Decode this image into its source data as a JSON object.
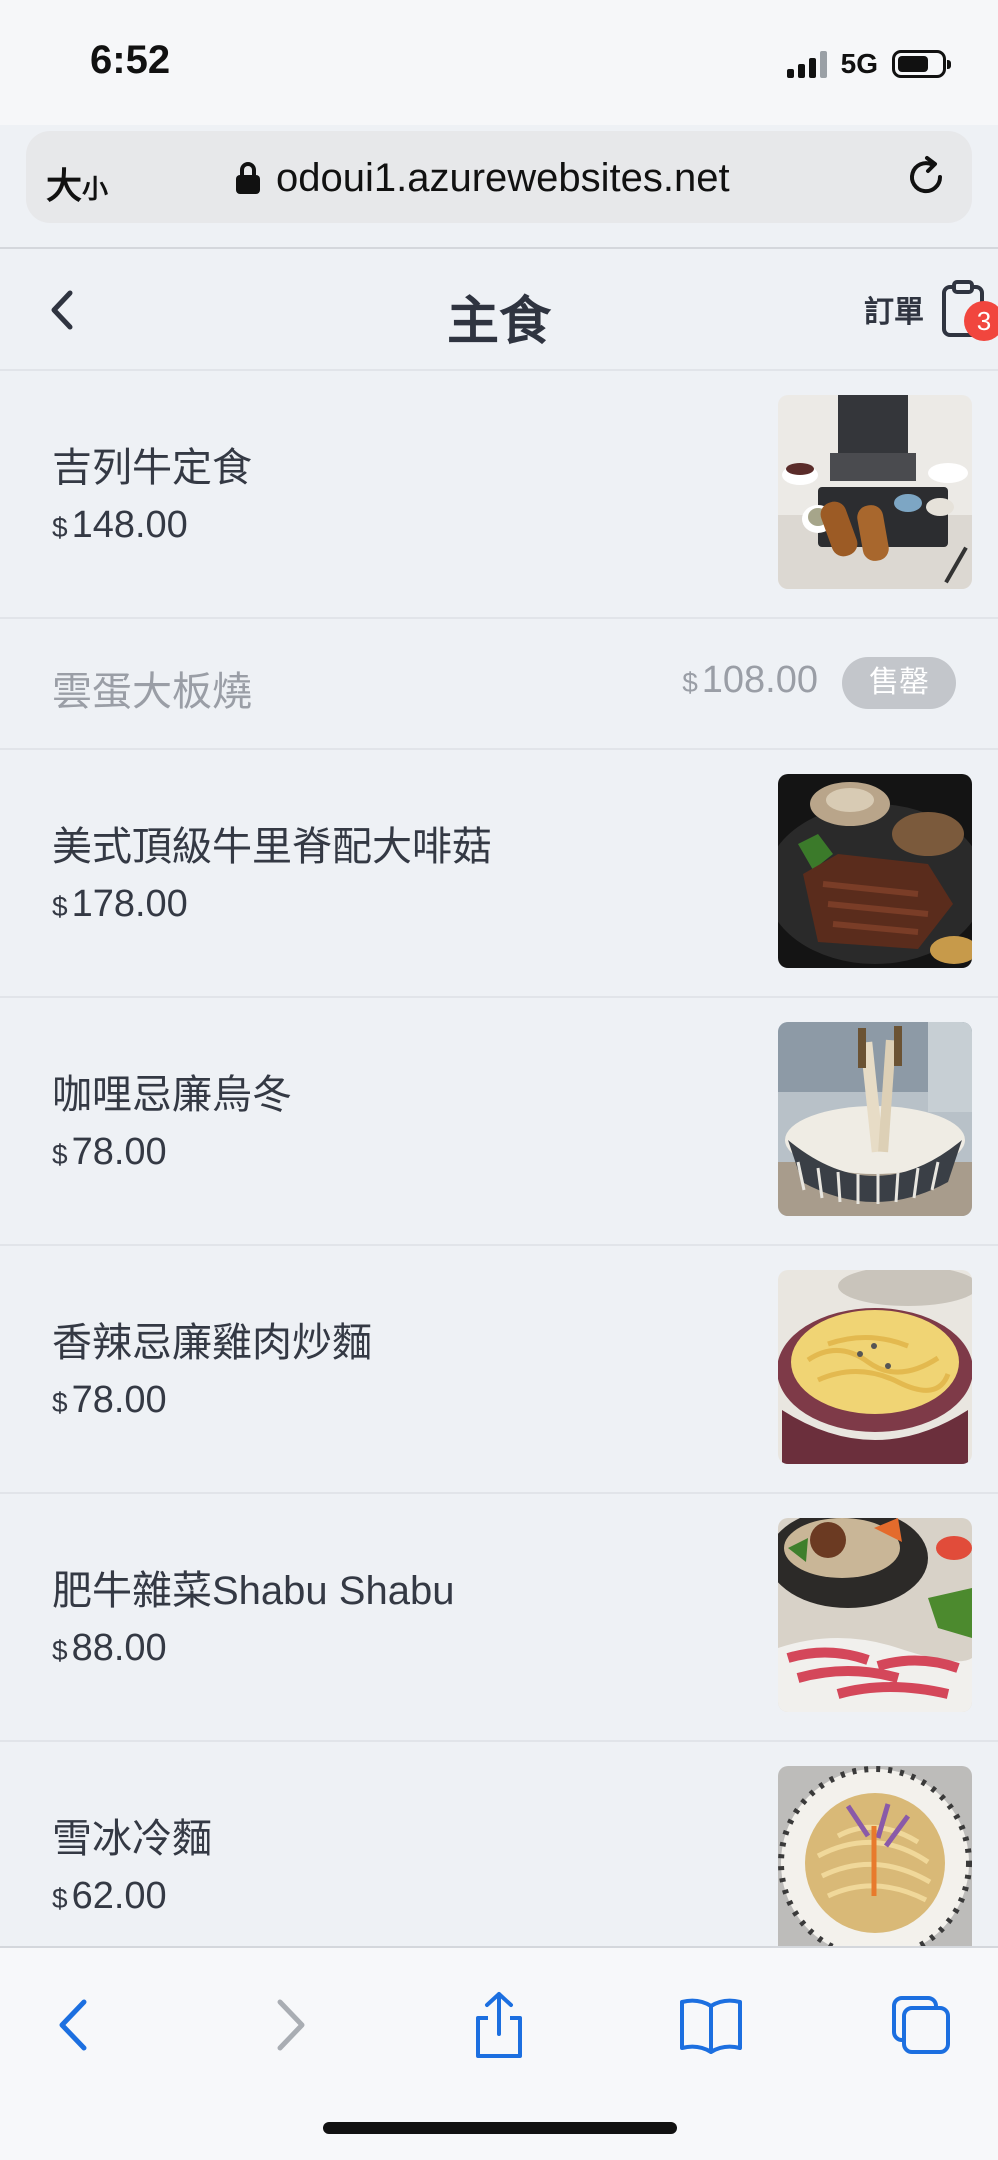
{
  "status_bar": {
    "time": "6:52",
    "network": "5G"
  },
  "address_bar": {
    "text_size_label": "大",
    "text_size_label_small": "小",
    "url": "odoui1.azurewebsites.net"
  },
  "header": {
    "title": "主食",
    "order_label": "訂單",
    "order_count": "3"
  },
  "menu": {
    "currency": "$",
    "sold_out_label": "售罄",
    "items": [
      {
        "name": "吉列牛定食",
        "price": "148.00",
        "image": "tonkatsu-beef-set-photo"
      },
      {
        "name": "雲蛋大板燒",
        "price": "108.00",
        "sold_out": true
      },
      {
        "name": "美式頂級牛里脊配大啡菇",
        "price": "178.00",
        "image": "steak-mushroom-photo"
      },
      {
        "name": "咖哩忌廉烏冬",
        "price": "78.00",
        "image": "curry-cream-udon-photo"
      },
      {
        "name": "香辣忌廉雞肉炒麵",
        "price": "78.00",
        "image": "spicy-cream-chicken-noodle-photo"
      },
      {
        "name": "肥牛雜菜Shabu Shabu",
        "price": "88.00",
        "image": "beef-shabu-shabu-photo"
      },
      {
        "name": "雪冰冷麵",
        "price": "62.00",
        "image": "cold-noodle-photo"
      }
    ]
  },
  "colors": {
    "accent_blue": "#1c6fe0",
    "badge_red": "#f1463e",
    "background": "#eef1f5"
  }
}
